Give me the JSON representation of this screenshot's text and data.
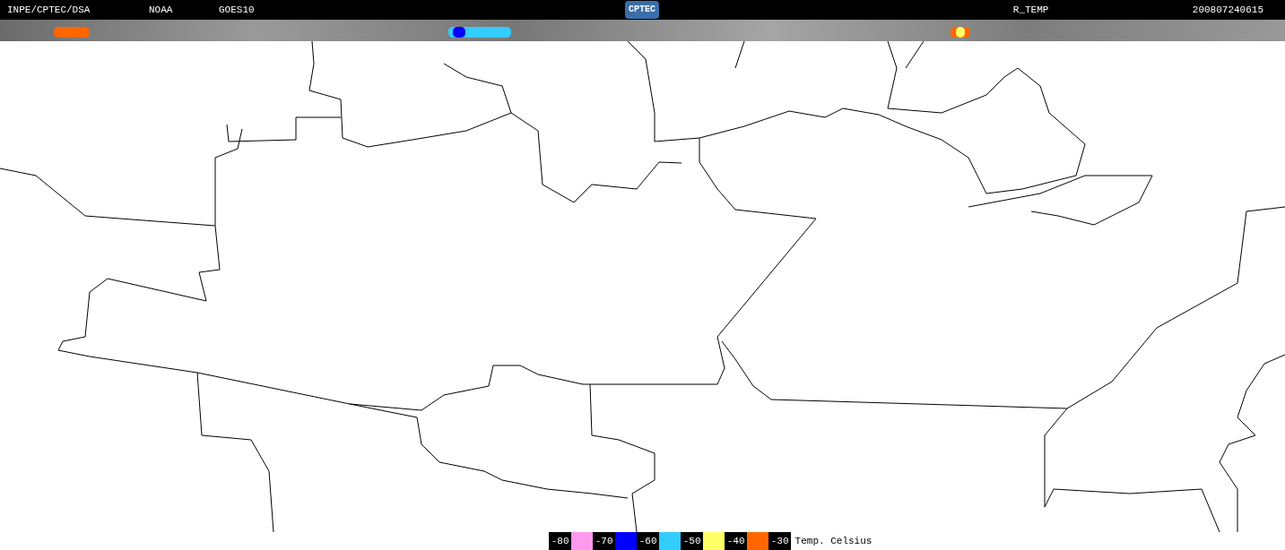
{
  "header": {
    "labels": [
      "INPE/CPTEC/DSA",
      "NOAA",
      "GOES10"
    ],
    "logo": "CPTEC",
    "product": "R_TEMP",
    "timestamp": "200807240615"
  },
  "legend": {
    "stops": [
      {
        "label": "-80",
        "color": "#ff99ee"
      },
      {
        "label": "-70",
        "color": "#0000ff"
      },
      {
        "label": "-60",
        "color": "#33ccff"
      },
      {
        "label": "-50",
        "color": "#ffff66"
      },
      {
        "label": "-40",
        "color": "#ff6600"
      },
      {
        "label": "-30"
      }
    ],
    "unit": "Temp. Celsius"
  }
}
